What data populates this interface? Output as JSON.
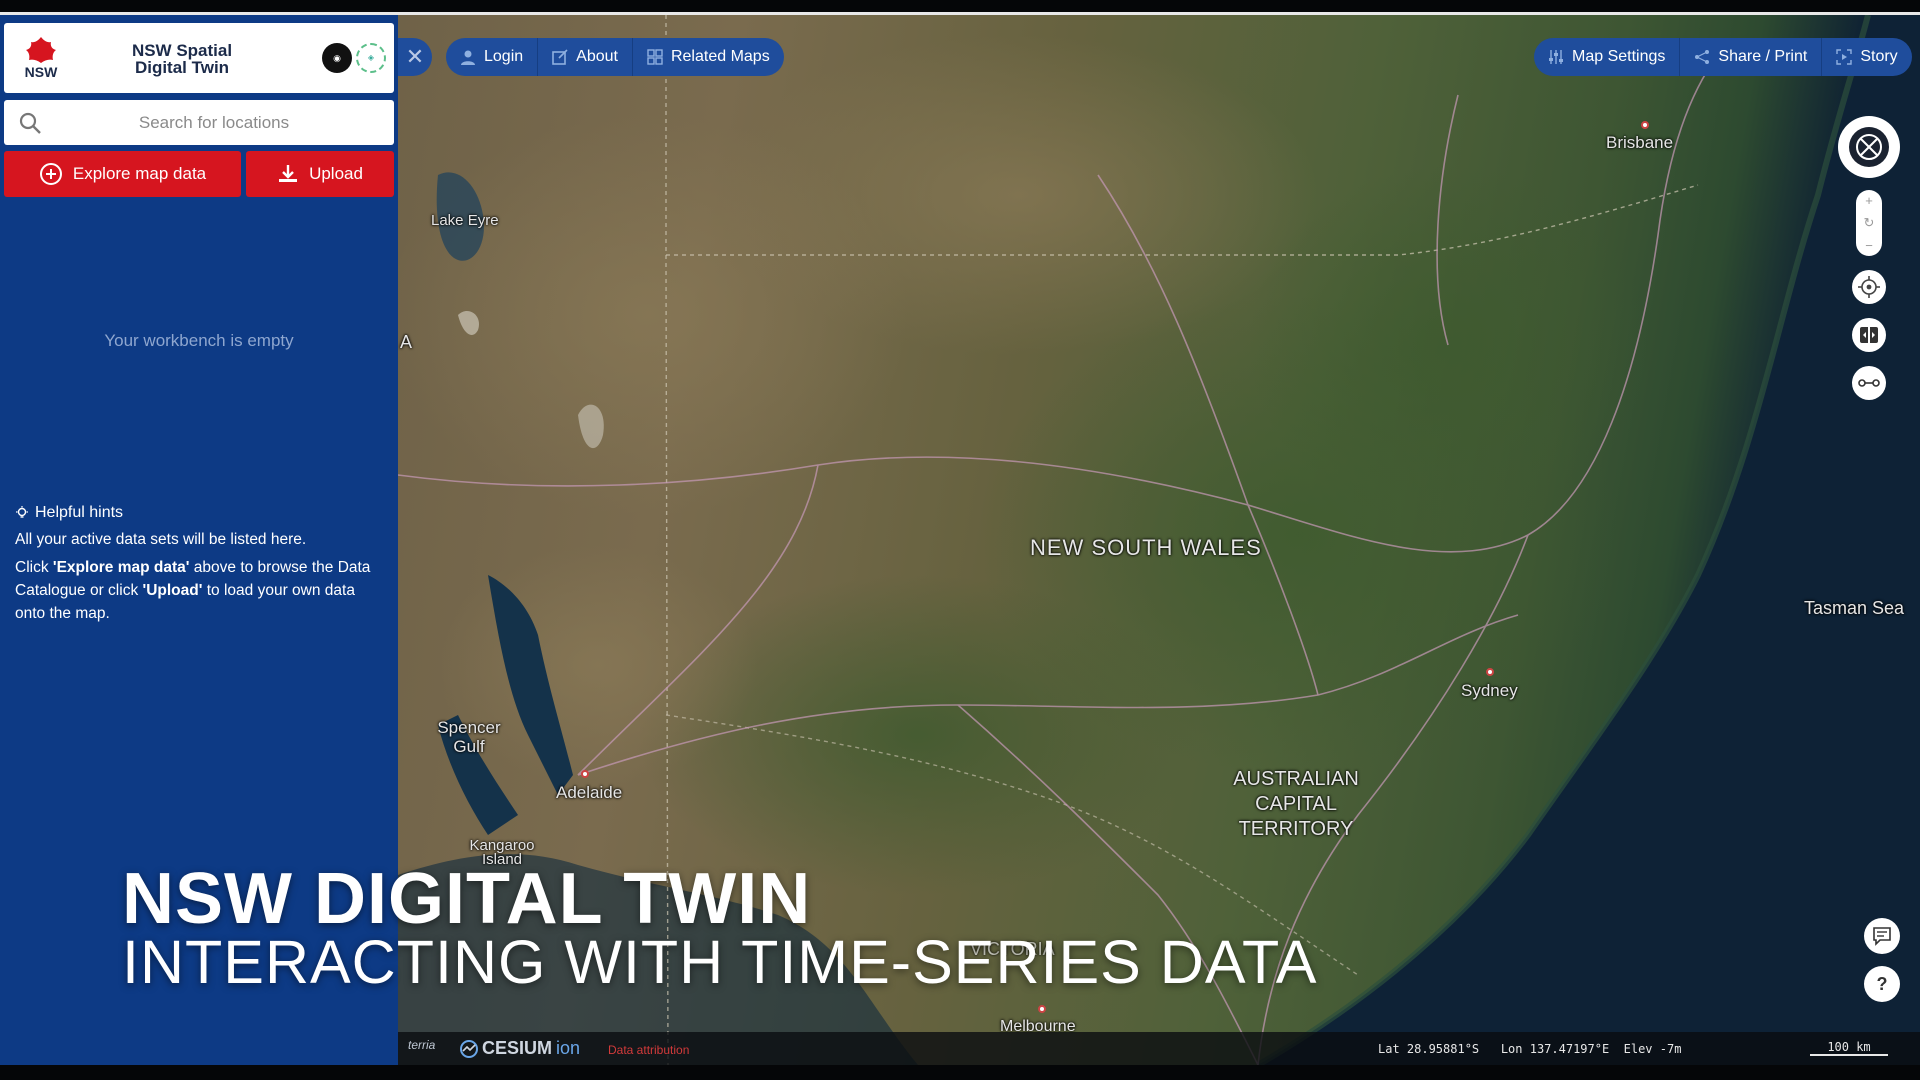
{
  "brand": {
    "title": "NSW Spatial Digital Twin",
    "logo_text": "NSW",
    "badge1_icon": "csiro-logo-icon",
    "badge2_icon": "data61-logo-icon"
  },
  "search": {
    "placeholder": "Search for locations"
  },
  "actions": {
    "explore_label": "Explore map data",
    "upload_label": "Upload"
  },
  "workbench": {
    "empty_text": "Your workbench is empty"
  },
  "hints": {
    "title": "Helpful hints",
    "line1": "All your active data sets will be listed here.",
    "line2_pre": "Click ",
    "line2_b1": "'Explore map data'",
    "line2_mid": " above to browse the Data Catalogue or click ",
    "line2_b2": "'Upload'",
    "line2_post": " to load your own data onto the map."
  },
  "toolbar": {
    "login": "Login",
    "about": "About",
    "related_maps": "Related Maps",
    "map_settings": "Map Settings",
    "share_print": "Share / Print",
    "story": "Story"
  },
  "map_labels": {
    "brisbane": "Brisbane",
    "nsw": "NEW SOUTH WALES",
    "sydney": "Sydney",
    "tasman": "Tasman Sea",
    "act": "AUSTRALIAN CAPITAL TERRITORY",
    "adelaide": "Adelaide",
    "spencer": "Spencer Gulf",
    "kangaroo": "Kangaroo Island",
    "lake_eyre": "Lake Eyre",
    "melbourne": "Melbourne",
    "victoria": "VICTORIA",
    "sa_edge": "A"
  },
  "overlay": {
    "title": "NSW DIGITAL TWIN",
    "subtitle": "INTERACTING WITH TIME-SERIES DATA"
  },
  "bottom": {
    "terria": "terria",
    "cesium": "CESIUM",
    "ion": "ion",
    "attribution": "Data attribution",
    "coords": "Lat 28.95881°S   Lon 137.47197°E  Elev -7m",
    "scale": "100 km"
  },
  "colors": {
    "sidebar": "#0d3a85",
    "accent_red": "#d6151f",
    "toolbar": "#1f4d9c"
  }
}
